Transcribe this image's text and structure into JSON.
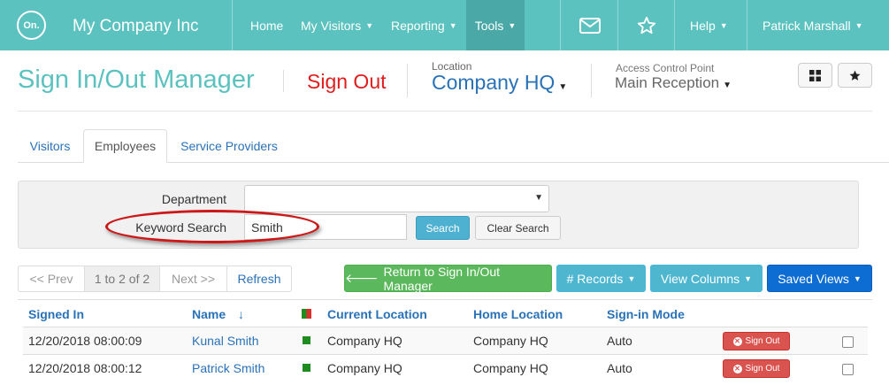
{
  "nav": {
    "logo": "On.",
    "company": "My Company Inc",
    "items": [
      {
        "label": "Home",
        "dropdown": false
      },
      {
        "label": "My Visitors",
        "dropdown": true
      },
      {
        "label": "Reporting",
        "dropdown": true
      },
      {
        "label": "Tools",
        "dropdown": true,
        "active": true
      }
    ],
    "help": "Help",
    "user": "Patrick Marshall"
  },
  "header": {
    "title": "Sign In/Out Manager",
    "sign_out": "Sign Out",
    "location_label": "Location",
    "location_value": "Company HQ",
    "acp_label": "Access Control Point",
    "acp_value": "Main Reception"
  },
  "tabs": [
    {
      "label": "Visitors",
      "active": false
    },
    {
      "label": "Employees",
      "active": true
    },
    {
      "label": "Service Providers",
      "active": false
    }
  ],
  "filter": {
    "department_label": "Department",
    "department_value": "",
    "keyword_label": "Keyword Search",
    "keyword_value": "Smith",
    "search_button": "Search",
    "clear_button": "Clear Search"
  },
  "pager": {
    "prev": "<< Prev",
    "info": "1 to 2 of 2",
    "next": "Next >>",
    "refresh": "Refresh"
  },
  "actions": {
    "return": "Return to Sign In/Out Manager",
    "records": "# Records",
    "view_columns": "View Columns",
    "saved_views": "Saved Views"
  },
  "table": {
    "columns": {
      "signed_in": "Signed In",
      "name": "Name",
      "sort_indicator": "↓",
      "current_location": "Current Location",
      "home_location": "Home Location",
      "sign_in_mode": "Sign-in Mode"
    },
    "rows": [
      {
        "signed_in": "12/20/2018 08:00:09",
        "name": "Kunal Smith",
        "status": "in",
        "current_location": "Company HQ",
        "home_location": "Company HQ",
        "sign_in_mode": "Auto",
        "action": "Sign Out"
      },
      {
        "signed_in": "12/20/2018 08:00:12",
        "name": "Patrick Smith",
        "status": "in",
        "current_location": "Company HQ",
        "home_location": "Company HQ",
        "sign_in_mode": "Auto",
        "action": "Sign Out"
      }
    ]
  },
  "colors": {
    "nav_bg": "#5bc2c0",
    "accent_blue": "#2a72b8",
    "sign_out_red": "#e01c1c",
    "status_green": "#1e8c1e",
    "status_red": "#d9302c",
    "annotation_red": "#cc1818"
  },
  "icons": [
    "envelope-icon",
    "star-icon",
    "grid-icon",
    "star-icon",
    "arrow-left-icon",
    "x-circle-icon"
  ]
}
